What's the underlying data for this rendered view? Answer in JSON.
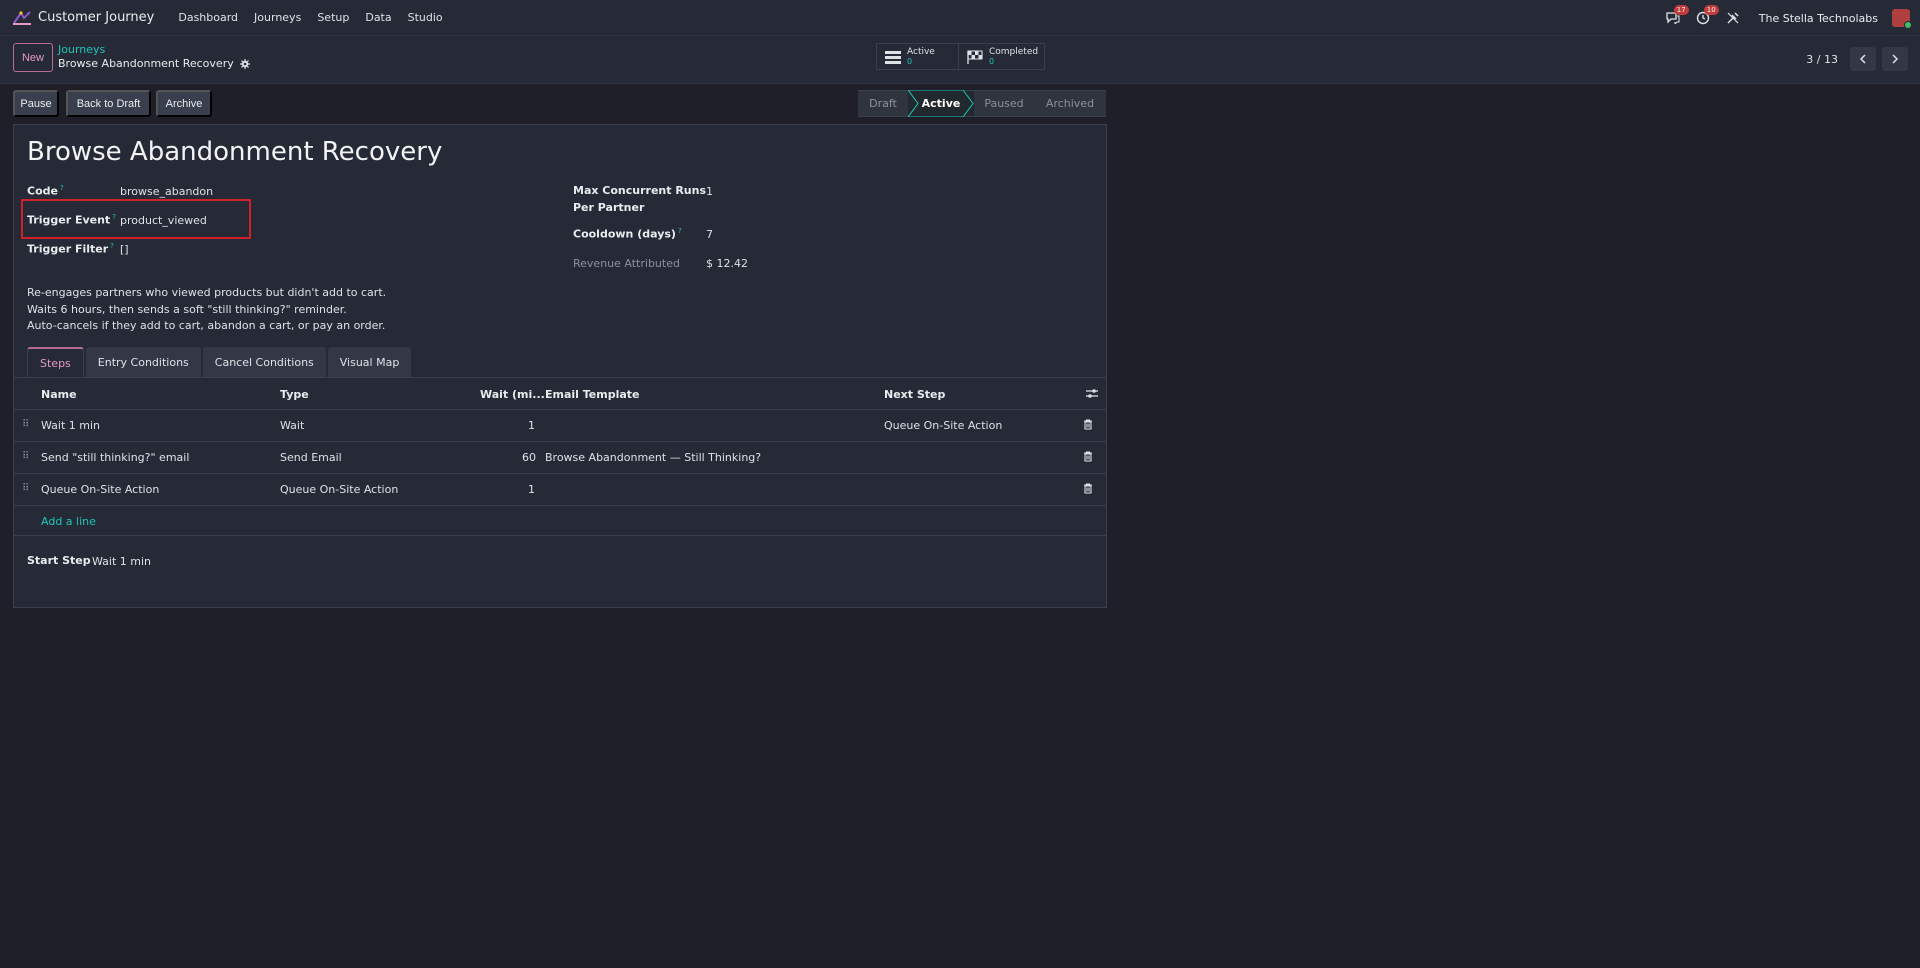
{
  "navbar": {
    "app_name": "Customer Journey",
    "menu": [
      "Dashboard",
      "Journeys",
      "Setup",
      "Data",
      "Studio"
    ],
    "messages_count": "17",
    "activities_count": "10",
    "company": "The Stella Technolabs"
  },
  "control": {
    "new_label": "New",
    "breadcrumb_parent": "Journeys",
    "breadcrumb_current": "Browse Abandonment Recovery",
    "stat_active_label": "Active",
    "stat_active_value": "0",
    "stat_completed_label": "Completed",
    "stat_completed_value": "0",
    "pager": "3 / 13"
  },
  "actions": {
    "pause": "Pause",
    "back_to_draft": "Back to Draft",
    "archive": "Archive"
  },
  "statusbar": {
    "stages": [
      "Draft",
      "Active",
      "Paused",
      "Archived"
    ],
    "current": "Active"
  },
  "form": {
    "title": "Browse Abandonment Recovery",
    "code_label": "Code",
    "code_value": "browse_abandon",
    "trigger_event_label": "Trigger Event",
    "trigger_event_value": "product_viewed",
    "trigger_filter_label": "Trigger Filter",
    "trigger_filter_value": "[]",
    "max_runs_label_1": "Max Concurrent Runs",
    "max_runs_label_2": "Per Partner",
    "max_runs_value": "1",
    "cooldown_label": "Cooldown (days)",
    "cooldown_value": "7",
    "revenue_label": "Revenue Attributed",
    "revenue_value": "$ 12.42",
    "help_mark": "?",
    "description": [
      "Re-engages partners who viewed products but didn't add to cart.",
      "Waits 6 hours, then sends a soft \"still thinking?\" reminder.",
      "Auto-cancels if they add to cart, abandon a cart, or pay an order."
    ]
  },
  "tabs": [
    "Steps",
    "Entry Conditions",
    "Cancel Conditions",
    "Visual Map"
  ],
  "table": {
    "headers": {
      "name": "Name",
      "type": "Type",
      "wait": "Wait (mi...",
      "template": "Email Template",
      "next": "Next Step"
    },
    "rows": [
      {
        "name": "Wait 1 min",
        "type": "Wait",
        "wait": "1",
        "template": "",
        "next": "Queue On-Site Action"
      },
      {
        "name": "Send \"still thinking?\" email",
        "type": "Send Email",
        "wait": "60",
        "template": "Browse Abandonment — Still Thinking?",
        "next": ""
      },
      {
        "name": "Queue On-Site Action",
        "type": "Queue On-Site Action",
        "wait": "1",
        "template": "",
        "next": ""
      }
    ],
    "add_line": "Add a line"
  },
  "start_step": {
    "label": "Start Step",
    "value": "Wait 1 min"
  },
  "colors": {
    "accent": "#1ec6b7",
    "brand": "#b56c98",
    "highlight": "#d0202a",
    "background": "#1e1f28"
  }
}
